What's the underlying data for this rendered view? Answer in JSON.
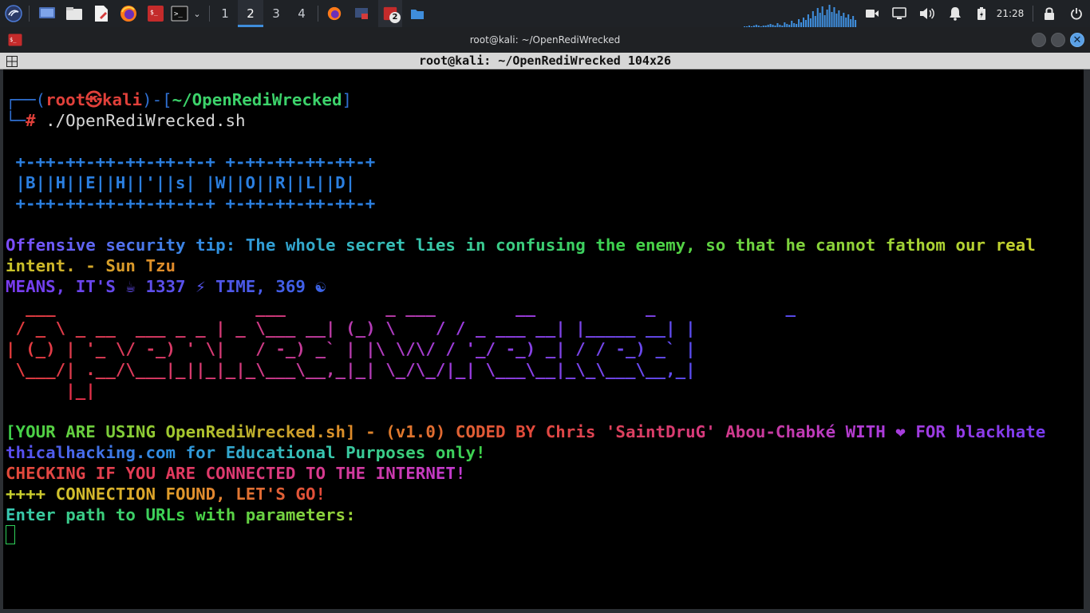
{
  "panel": {
    "workspaces": [
      "1",
      "2",
      "3",
      "4"
    ],
    "active_workspace": "2",
    "taskbar_badge": "2",
    "clock": "21:28",
    "icons": [
      "kali-menu-icon",
      "desktop-icon",
      "file-manager-icon",
      "text-editor-icon",
      "firefox-icon",
      "terminal-emulator-icon",
      "terminal-icon",
      "chevron-down-icon",
      "video-icon",
      "display-icon",
      "volume-icon",
      "notification-bell-icon",
      "battery-icon",
      "lock-icon",
      "power-icon"
    ]
  },
  "window": {
    "title": "root@kali: ~/OpenRediWrecked",
    "tab_title": "root@kali: ~/OpenRediWrecked 104x26"
  },
  "terminal": {
    "prompt": {
      "open": "┌──(",
      "user": "root㉿kali",
      "mid": ")-[",
      "path": "~/OpenRediWrecked",
      "close": "]",
      "corner": "└─",
      "hash": "#",
      "command": " ./OpenRediWrecked.sh"
    },
    "banner": [
      " +-++-++-++-++-++-+-+ +-++-++-++-++-+",
      " |B||H||E||H||'||s| |W||O||R||L||D|",
      " +-++-++-++-++-++-+-+ +-++-++-++-++-+"
    ],
    "tip_line1": "Offensive security tip: The whole secret lies in confusing the enemy, so that he cannot fathom our real",
    "tip_line2": "intent. - Sun Tzu",
    "means_line": "MEANS, IT'S ☕ 1337 ⚡ TIME, 369 ☯",
    "ascii_art": [
      "  ___                    ___          _ ___        __           _             _",
      " / _ \\ _ __  ___ _ _ | _ \\___ __| (_) \\    / / _ ___ __| |_____ __| |",
      "| (_) | '_ \\/ -_) ' \\|   / -_) _` | |\\ \\/\\/ / '_/ -_) _| / / -_) _` |",
      " \\___/| .__/\\___|_||_|_|_\\___\\__,_|_| \\_/\\_/|_| \\___\\__|_\\_\\___\\__,_|",
      "      |_|"
    ],
    "using_line": "[YOUR ARE USING OpenRediWrecked.sh] - (v1.0) CODED BY Chris 'SaintDruG' Abou-Chabké WITH ❤ FOR blackhate",
    "site_line": "thicalhacking.com for Educational Purposes only!",
    "checking_line": "CHECKING IF YOU ARE CONNECTED TO THE INTERNET!",
    "found_line": "++++ CONNECTION FOUND, LET'S GO!",
    "enter_line": "Enter path to URLs with parameters:"
  },
  "colors": {
    "prompt_blue": "#2f6fd0",
    "prompt_red": "#e0403a",
    "path_green": "#3cd26a",
    "banner_blue": "#2b7fe0",
    "tip_start": "#7c4dff",
    "tip_end": "#c8d22e",
    "accent_blue": "#3f8edc"
  }
}
